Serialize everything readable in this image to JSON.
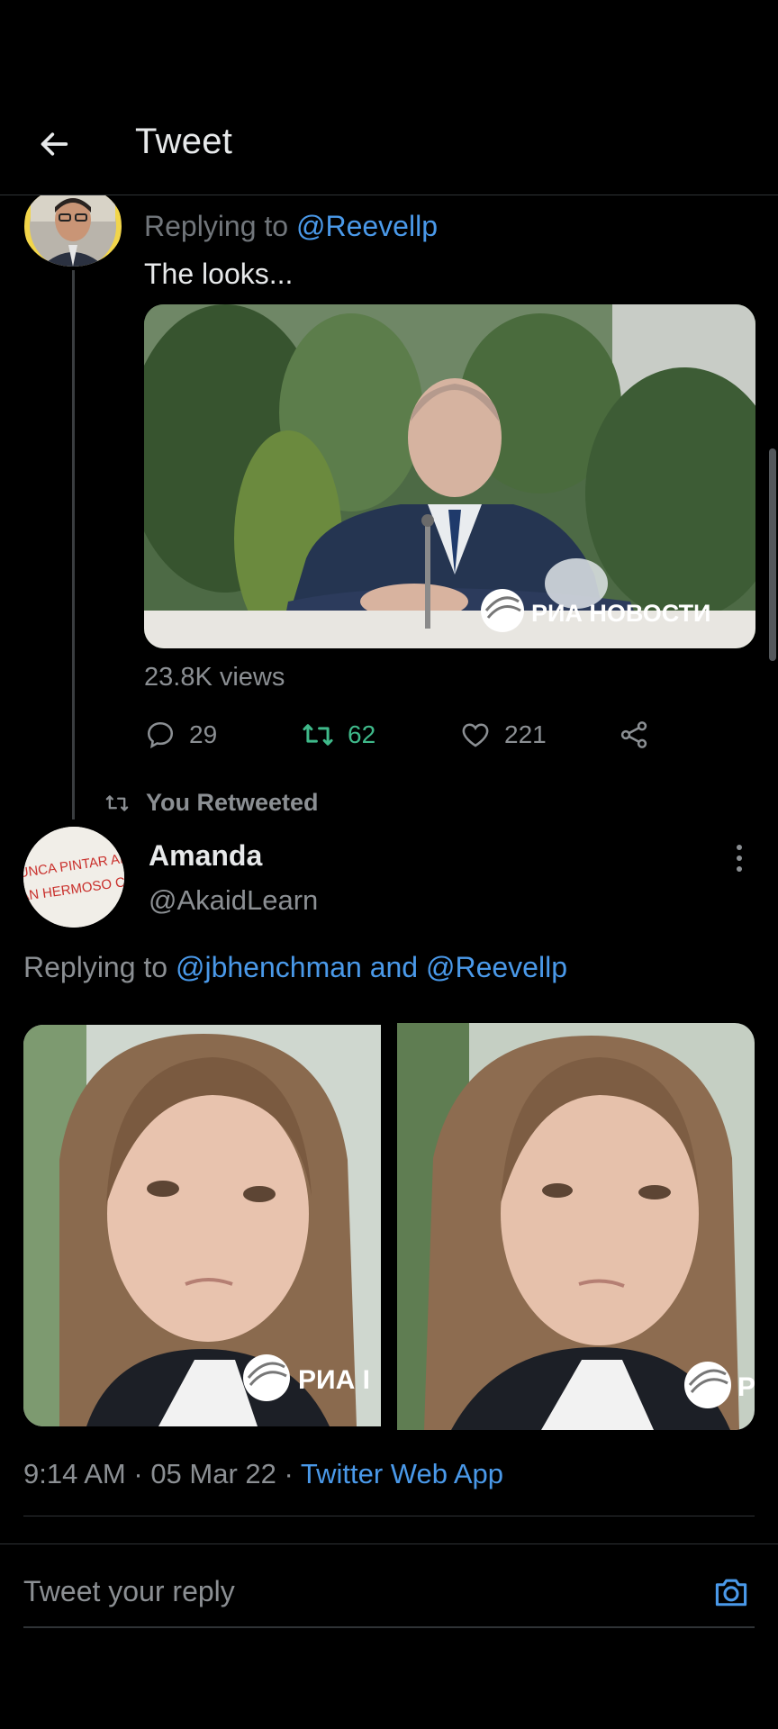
{
  "header": {
    "title": "Tweet"
  },
  "tweet1": {
    "replying_to_prefix": "Replying to ",
    "replying_to_handle": "@Reevellp",
    "text": "The looks...",
    "views": "23.8K views",
    "replies": "29",
    "retweets": "62",
    "likes": "221",
    "media_watermark": "РИА НОВОСТИ"
  },
  "retweet_label": "You Retweeted",
  "tweet2": {
    "name": "Amanda",
    "handle": "@AkaidLearn",
    "replying_to_prefix": "Replying to ",
    "replying_to_handles": "@jbhenchman and @Reevellp",
    "avatar_text": [
      "UNCA PINTAR ALGO",
      "AN HERMOSO COMO TU"
    ],
    "photo_left_watermark": "РИА I",
    "photo_right_watermark": "P",
    "time": "9:14 AM",
    "sep1": " · ",
    "date": "05 Mar 22",
    "sep2": " · ",
    "source": "Twitter Web App"
  },
  "reply_box": {
    "placeholder": "Tweet your reply"
  },
  "colors": {
    "background": "#000000",
    "accent_blue": "#4a99e9",
    "retweet_green": "#3fb98a",
    "muted_text": "#8b8f93",
    "avatar_ring": "#f2d54a"
  },
  "icons": [
    "arrow-left-icon",
    "comment-icon",
    "retweet-icon",
    "heart-icon",
    "share-icon",
    "more-vertical-icon",
    "camera-icon"
  ]
}
